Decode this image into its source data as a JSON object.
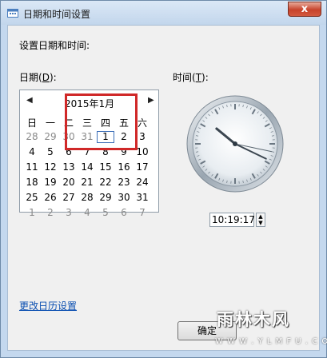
{
  "window": {
    "title": "日期和时间设置",
    "close_glyph": "x"
  },
  "instruction": "设置日期和时间:",
  "date_label": "日期(",
  "date_mnemonic": "D",
  "date_label_end": "):",
  "time_label": "时间(",
  "time_mnemonic": "T",
  "time_label_end": "):",
  "calendar": {
    "month_title": "2015年1月",
    "prev_glyph": "◀",
    "next_glyph": "▶",
    "weekdays": [
      "日",
      "一",
      "二",
      "三",
      "四",
      "五",
      "六"
    ],
    "weeks": [
      [
        "28",
        "29",
        "30",
        "31",
        "1",
        "2",
        "3"
      ],
      [
        "4",
        "5",
        "6",
        "7",
        "8",
        "9",
        "10"
      ],
      [
        "11",
        "12",
        "13",
        "14",
        "15",
        "16",
        "17"
      ],
      [
        "18",
        "19",
        "20",
        "21",
        "22",
        "23",
        "24"
      ],
      [
        "25",
        "26",
        "27",
        "28",
        "29",
        "30",
        "31"
      ],
      [
        "1",
        "2",
        "3",
        "4",
        "5",
        "6",
        "7"
      ]
    ],
    "selected_day": "1",
    "highlight_color": "#d02828"
  },
  "time_value": "10:19:17",
  "clock": {
    "hour": 10,
    "minute": 19,
    "second": 17
  },
  "change_calendar_link": "更改日历设置",
  "ok_button": "确定",
  "watermark": {
    "title": "雨林木风",
    "subtitle": "W W W . Y L M F U . C O M"
  }
}
